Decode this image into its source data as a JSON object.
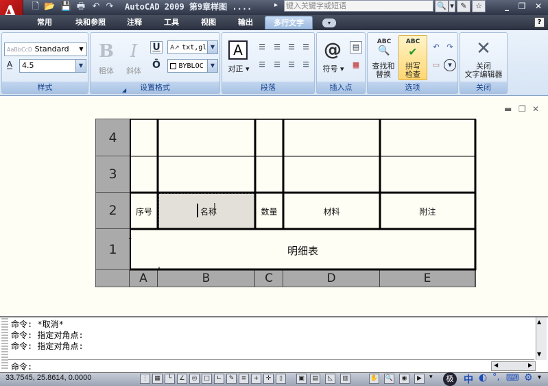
{
  "app": {
    "logo_letter": "A",
    "title": "AutoCAD 2009  第9章样图 ....",
    "search_placeholder": "键入关键字或短语"
  },
  "quick_access": {
    "icons": [
      "new-icon",
      "open-icon",
      "save-icon",
      "print-icon",
      "undo-icon",
      "redo-icon"
    ]
  },
  "tabs": [
    {
      "label": "常用"
    },
    {
      "label": "块和参照"
    },
    {
      "label": "注释"
    },
    {
      "label": "工具"
    },
    {
      "label": "视图"
    },
    {
      "label": "输出"
    },
    {
      "label": "多行文字"
    }
  ],
  "help_label": "?",
  "ribbon": {
    "style_panel": {
      "label": "样式",
      "style_value": "Standard",
      "style_preview": "AaBbCcD",
      "height_value": "4.5",
      "height_icon": "A"
    },
    "format_panel": {
      "label": "设置格式",
      "bold": "粗体",
      "italic": "斜体",
      "underline": "U",
      "overline": "Ō",
      "font_value": "txt,gl",
      "color_value": "BYBLOC"
    },
    "paragraph_panel": {
      "label": "段落",
      "justify_label": "对正"
    },
    "insert_panel": {
      "label": "插入点",
      "symbol_label": "符号",
      "symbol_glyph": "@"
    },
    "options_panel": {
      "label": "选项",
      "find_line1": "查找和",
      "find_line2": "替换",
      "find_badge": "ABC",
      "spell_line1": "拼写",
      "spell_line2": "检查",
      "spell_badge": "ABC"
    },
    "close_panel": {
      "label": "关闭",
      "close_line1": "关闭",
      "close_line2": "文字编辑器"
    }
  },
  "table": {
    "row_headers": [
      "4",
      "3",
      "2",
      "1"
    ],
    "col_headers": [
      "A",
      "B",
      "C",
      "D",
      "E"
    ],
    "header_row": [
      "序号",
      "名称",
      "数量",
      "材料",
      "附注"
    ],
    "title_row": "明细表"
  },
  "command": {
    "lines": [
      "命令: *取消*",
      "命令: 指定对角点:",
      "命令: 指定对角点:"
    ],
    "prompt": "命令:"
  },
  "status": {
    "coords": "33.7545,  25.8614, 0.0000"
  },
  "ime": {
    "lang": "中"
  },
  "colors": {
    "title_bar": "#2d3446",
    "ribbon_bg": "#dde9f7",
    "canvas_bg": "#fffef4",
    "active_tab": "#9cbbe0",
    "header_gray": "#aaaaaa"
  }
}
